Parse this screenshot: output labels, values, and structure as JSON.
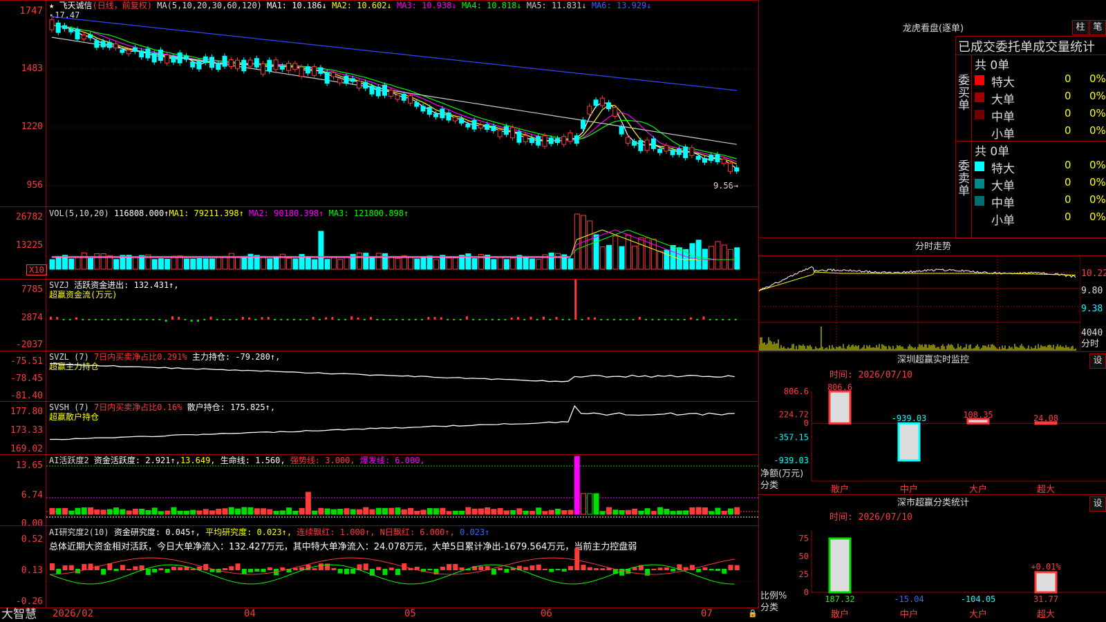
{
  "app": {
    "brand": "大智慧",
    "stock_name": "飞天诚信",
    "period_tag": "(日线，前复权)"
  },
  "main_legend": {
    "ma_label": "MA(5,10,20,30,60,120)",
    "ma1": "MA1: 10.186↓",
    "ma2": "MA2: 10.602↓",
    "ma3": "MA3: 10.938↓",
    "ma4": "MA4: 10.818↓",
    "ma5": "MA5: 11.831↓",
    "ma6": "MA6: 13.929↓",
    "high_mark": "17.47",
    "low_mark": "9.56"
  },
  "main_axis": [
    "1747",
    "1483",
    "1220",
    "956"
  ],
  "vol_panel": {
    "legend": "VOL(5,10,20)",
    "value": "116808.000↑",
    "ma1": "MA1: 79211.398↑",
    "ma2": "MA2: 90180.398↑",
    "ma3": "MA3: 121800.898↑",
    "axis": [
      "26782",
      "13225"
    ],
    "unit": "X10"
  },
  "svzj_panel": {
    "legend": "SVZJ",
    "text": "活跃资金进出: 132.431↑,",
    "subtitle": "超赢资金流(万元)",
    "axis": [
      "7785",
      "2874",
      "-2037"
    ]
  },
  "svzl_panel": {
    "legend": "SVZL (7)",
    "ratio": "7日内买卖净占比0.291%",
    "text": "主力持仓: -79.280↑,",
    "subtitle": "超赢主力持仓",
    "axis": [
      "-75.51",
      "-78.45",
      "-81.40"
    ]
  },
  "svsh_panel": {
    "legend": "SVSH (7)",
    "ratio": "7日内买卖净占比0.16%",
    "text": "散户持仓: 175.825↑,",
    "subtitle": "超赢散户持仓",
    "axis": [
      "177.80",
      "173.33",
      "169.02"
    ]
  },
  "ai1_panel": {
    "legend": "AI活跃度2",
    "text": "资金活跃度: 2.921↑,",
    "val2": "13.649,",
    "life": "生命线: 1.560,",
    "strong": "强势线: 3.000,",
    "burst": "爆发线: 6.000,",
    "axis": [
      "13.65",
      "6.74",
      "0.00"
    ]
  },
  "ai2_panel": {
    "legend": "AI研究度2(10)",
    "text": "资金研究度: 0.045↑,",
    "avg": "平均研究度: 0.023↑,",
    "consec": "连续飘红: 1.000↑,",
    "nday": "N日飘红: 6.000↑,",
    "last": "0.023↑",
    "summary": "总体近期大资金相对活跃，今日大单净流入：132.427万元，其中特大单净流入：24.078万元，大单5日累计净出-1679.564万元，当前主力控盘弱",
    "axis": [
      "0.52",
      "0.13",
      "-0.26"
    ]
  },
  "x_axis": [
    "2026/02",
    "04",
    "05",
    "06",
    "07"
  ],
  "right": {
    "lhb_title": "龙虎看盘(逐单)",
    "btn_zhu": "柱",
    "btn_bi": "笔",
    "lhb_subtitle": "已成交委托单成交量统计",
    "buy_label": "委买单",
    "sell_label": "委卖单",
    "buy_total": "共 0单",
    "sell_total": "共 0单",
    "buy_rows": [
      {
        "name": "特大",
        "count": "0",
        "pct": "0%",
        "color": "#ff0000"
      },
      {
        "name": "大单",
        "count": "0",
        "pct": "0%",
        "color": "#a00000"
      },
      {
        "name": "中单",
        "count": "0",
        "pct": "0%",
        "color": "#700000"
      },
      {
        "name": "小单",
        "count": "0",
        "pct": "0%",
        "color": ""
      }
    ],
    "sell_rows": [
      {
        "name": "特大",
        "count": "0",
        "pct": "0%",
        "color": "#00ffff"
      },
      {
        "name": "大单",
        "count": "0",
        "pct": "0%",
        "color": "#008888"
      },
      {
        "name": "中单",
        "count": "0",
        "pct": "0%",
        "color": "#006f6f"
      },
      {
        "name": "小单",
        "count": "0",
        "pct": "0%",
        "color": ""
      }
    ],
    "intraday_title": "分时走势",
    "intraday_axis": [
      "10.22",
      "9.80",
      "9.38",
      "4040"
    ],
    "intraday_unit": "分时",
    "monitor_title": "深圳超赢实时监控",
    "monitor_btn": "设",
    "monitor_time": "时间: 2026/07/10",
    "monitor_axis": [
      "806.6",
      "224.72",
      "0",
      "-357.15",
      "-939.03"
    ],
    "monitor_ylabel": "净额(万元)",
    "monitor_xlabel": "分类",
    "stats_title": "深市超赢分类统计",
    "stats_btn": "设",
    "stats_time": "时间: 2026/07/10",
    "stats_axis": [
      "75",
      "50",
      "25",
      "0"
    ],
    "stats_ylabel": "比例%",
    "stats_xlabel": "分类"
  },
  "chart_data": [
    {
      "type": "bar",
      "title": "深圳超赢实时监控",
      "categories": [
        "散户",
        "中户",
        "大户",
        "超大"
      ],
      "values": [
        806.6,
        -939.03,
        108.35,
        24.08
      ],
      "ylabel": "净额(万元)",
      "ylim": [
        -939.03,
        806.6
      ]
    },
    {
      "type": "bar",
      "title": "深市超赢分类统计",
      "categories": [
        "散户",
        "中户",
        "大户",
        "超大"
      ],
      "values": [
        187.32,
        -15.04,
        -104.05,
        31.77
      ],
      "annotation": "+0.01%",
      "ylabel": "比例%",
      "ylim": [
        0,
        75
      ]
    }
  ]
}
